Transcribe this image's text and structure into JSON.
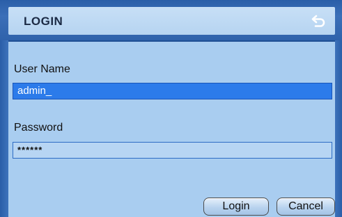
{
  "dialog": {
    "title": "LOGIN",
    "back_icon": "return-arrow-icon"
  },
  "form": {
    "username_label": "User Name",
    "username_value": "admin_",
    "password_label": "Password",
    "password_value": "******"
  },
  "buttons": {
    "login_label": "Login",
    "cancel_label": "Cancel"
  },
  "colors": {
    "frame": "#2a5ea8",
    "panel": "#a9cdf0",
    "active_field": "#2c7bea"
  }
}
